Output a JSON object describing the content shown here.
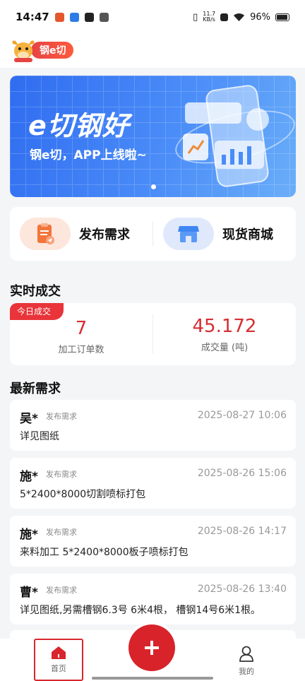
{
  "status_bar": {
    "time": "14:47",
    "net_speed_value": "11.7",
    "net_speed_unit": "KB/s",
    "battery": "96%"
  },
  "header": {
    "logo_text": "钢e切"
  },
  "banner": {
    "title": "e切钢好",
    "subtitle": "钢e切，APP上线啦~",
    "accent_color": "#2f6cf0"
  },
  "quick_actions": [
    {
      "label": "发布需求",
      "icon": "clipboard-send-icon"
    },
    {
      "label": "现货商城",
      "icon": "shop-icon"
    }
  ],
  "realtime": {
    "title": "实时成交",
    "tag": "今日成交",
    "stats": [
      {
        "value": "7",
        "label": "加工订单数"
      },
      {
        "value": "45.172",
        "label": "成交量 (吨)"
      }
    ]
  },
  "latest": {
    "title": "最新需求",
    "items": [
      {
        "name": "吴*",
        "type": "发布需求",
        "time": "2025-08-27 10:06",
        "desc": "详见图纸"
      },
      {
        "name": "施*",
        "type": "发布需求",
        "time": "2025-08-26 15:06",
        "desc": "5*2400*8000切割喷标打包"
      },
      {
        "name": "施*",
        "type": "发布需求",
        "time": "2025-08-26 14:17",
        "desc": "来料加工 5*2400*8000板子喷标打包"
      },
      {
        "name": "曹*",
        "type": "发布需求",
        "time": "2025-08-26 13:40",
        "desc": "详见图纸,另需槽钢6.3号 6米4根， 槽钢14号6米1根。"
      }
    ]
  },
  "bottom_nav": {
    "home": "首页",
    "me": "我的",
    "brand_color": "#d8232a"
  }
}
